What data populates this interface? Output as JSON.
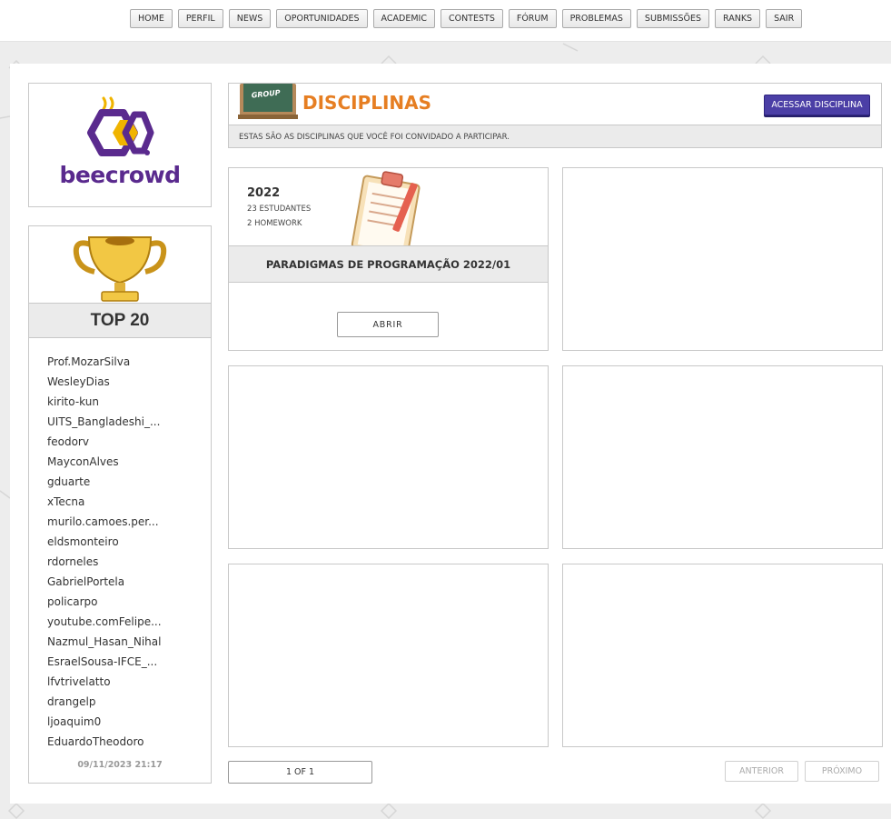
{
  "nav": {
    "items": [
      "HOME",
      "PERFIL",
      "NEWS",
      "OPORTUNIDADES",
      "ACADEMIC",
      "CONTESTS",
      "FÓRUM",
      "PROBLEMAS",
      "SUBMISSÕES",
      "RANKS",
      "SAIR"
    ]
  },
  "brand": {
    "logo_text": "beecrowd",
    "color": "#5a2a8e"
  },
  "ranking": {
    "title": "TOP 20",
    "users": [
      "Prof.MozarSilva",
      "WesleyDias",
      "kirito-kun",
      "UITS_Bangladeshi_...",
      "feodorv",
      "MayconAlves",
      "gduarte",
      "xTecna",
      "murilo.camoes.per...",
      "eldsmonteiro",
      "rdorneles",
      "GabrielPortela",
      "policarpo",
      "youtube.comFelipe...",
      "Nazmul_Hasan_Nihal",
      "EsraelSousa-IFCE_...",
      "lfvtrivelatto",
      "drangelp",
      "ljoaquim0",
      "EduardoTheodoro"
    ],
    "updated": "09/11/2023 21:17"
  },
  "header": {
    "badge": "GROUP",
    "title": "DISCIPLINAS",
    "access_button": "ACESSAR DISCIPLINA",
    "subtitle": "ESTAS SÃO AS DISCIPLINAS QUE VOCÊ FOI CONVIDADO A PARTICIPAR."
  },
  "courses": [
    {
      "year": "2022",
      "students": "23 ESTUDANTES",
      "homework": "2 HOMEWORK",
      "name": "PARADIGMAS DE PROGRAMAÇÃO 2022/01",
      "open_label": "ABRIR"
    }
  ],
  "pagination": {
    "info": "1 OF 1",
    "prev": "ANTERIOR",
    "next": "PRÓXIMO"
  },
  "colors": {
    "accent_orange": "#e67e22",
    "primary_purple": "#4b3fa6"
  },
  "icons": [
    "group-chalkboard-icon",
    "trophy-icon",
    "clipboard-icon",
    "beecrowd-logo-icon"
  ]
}
